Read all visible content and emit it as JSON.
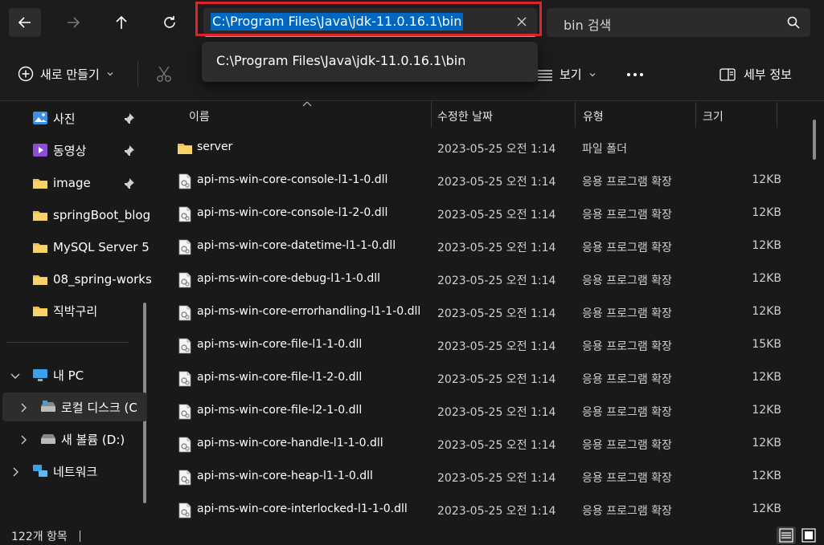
{
  "nav": {
    "address": "C:\\Program Files\\Java\\jdk-11.0.16.1\\bin",
    "search_placeholder": "bin 검색",
    "suggestion": "C:\\Program Files\\Java\\jdk-11.0.16.1\\bin",
    "icons": [
      "back-arrow-icon",
      "forward-arrow-icon",
      "up-arrow-icon",
      "refresh-icon",
      "close-icon",
      "search-icon"
    ]
  },
  "toolbar": {
    "new_label": "새로 만들기",
    "view_label": "보기",
    "details_label": "세부 정보"
  },
  "sidebar": {
    "items": [
      {
        "label": "사진",
        "icon": "photos-icon",
        "pinned": true
      },
      {
        "label": "동영상",
        "icon": "videos-icon",
        "pinned": true
      },
      {
        "label": "image",
        "icon": "folder-icon",
        "pinned": true
      },
      {
        "label": "springBoot_blog",
        "icon": "folder-icon"
      },
      {
        "label": "MySQL Server 5",
        "icon": "folder-icon"
      },
      {
        "label": "08_spring-works",
        "icon": "folder-icon"
      },
      {
        "label": "직박구리",
        "icon": "folder-icon"
      }
    ],
    "tree": [
      {
        "label": "내 PC",
        "icon": "pc-icon",
        "expanded": true
      },
      {
        "label": "로컬 디스크 (C",
        "icon": "drive-icon",
        "selected": true
      },
      {
        "label": "새 볼륨 (D:)",
        "icon": "drive-icon"
      },
      {
        "label": "네트워크",
        "icon": "network-icon"
      }
    ]
  },
  "columns": {
    "name": "이름",
    "date": "수정한 날짜",
    "type": "유형",
    "size": "크기"
  },
  "files": [
    {
      "name": "server",
      "date": "2023-05-25 오전 1:14",
      "type": "파일 폴더",
      "size": "",
      "kind": "folder"
    },
    {
      "name": "api-ms-win-core-console-l1-1-0.dll",
      "date": "2023-05-25 오전 1:14",
      "type": "응용 프로그램 확장",
      "size": "12KB",
      "kind": "dll"
    },
    {
      "name": "api-ms-win-core-console-l1-2-0.dll",
      "date": "2023-05-25 오전 1:14",
      "type": "응용 프로그램 확장",
      "size": "12KB",
      "kind": "dll"
    },
    {
      "name": "api-ms-win-core-datetime-l1-1-0.dll",
      "date": "2023-05-25 오전 1:14",
      "type": "응용 프로그램 확장",
      "size": "12KB",
      "kind": "dll"
    },
    {
      "name": "api-ms-win-core-debug-l1-1-0.dll",
      "date": "2023-05-25 오전 1:14",
      "type": "응용 프로그램 확장",
      "size": "12KB",
      "kind": "dll"
    },
    {
      "name": "api-ms-win-core-errorhandling-l1-1-0.dll",
      "date": "2023-05-25 오전 1:14",
      "type": "응용 프로그램 확장",
      "size": "12KB",
      "kind": "dll"
    },
    {
      "name": "api-ms-win-core-file-l1-1-0.dll",
      "date": "2023-05-25 오전 1:14",
      "type": "응용 프로그램 확장",
      "size": "15KB",
      "kind": "dll"
    },
    {
      "name": "api-ms-win-core-file-l1-2-0.dll",
      "date": "2023-05-25 오전 1:14",
      "type": "응용 프로그램 확장",
      "size": "12KB",
      "kind": "dll"
    },
    {
      "name": "api-ms-win-core-file-l2-1-0.dll",
      "date": "2023-05-25 오전 1:14",
      "type": "응용 프로그램 확장",
      "size": "12KB",
      "kind": "dll"
    },
    {
      "name": "api-ms-win-core-handle-l1-1-0.dll",
      "date": "2023-05-25 오전 1:14",
      "type": "응용 프로그램 확장",
      "size": "12KB",
      "kind": "dll"
    },
    {
      "name": "api-ms-win-core-heap-l1-1-0.dll",
      "date": "2023-05-25 오전 1:14",
      "type": "응용 프로그램 확장",
      "size": "12KB",
      "kind": "dll"
    },
    {
      "name": "api-ms-win-core-interlocked-l1-1-0.dll",
      "date": "2023-05-25 오전 1:14",
      "type": "응용 프로그램 확장",
      "size": "12KB",
      "kind": "dll"
    }
  ],
  "status": {
    "item_count": "122개 항목"
  },
  "colors": {
    "accent": "#4cc2ff",
    "selection": "#0067c0",
    "highlight_box": "#e0232b",
    "folder": "#f0c04a"
  }
}
